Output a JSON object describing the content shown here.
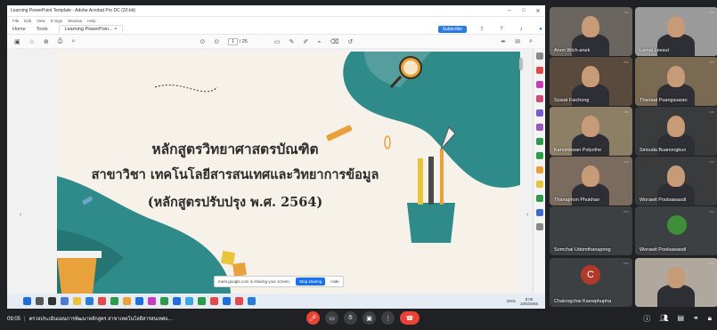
{
  "window": {
    "title": "Learning PowerPoint Template - Adobe Acrobat Pro DC (32-bit)",
    "controls": [
      "–",
      "□",
      "✕"
    ]
  },
  "menu": [
    "File",
    "Edit",
    "View",
    "E-Sign",
    "Window",
    "Help"
  ],
  "tabs": {
    "home": "Home",
    "tools": "Tools",
    "document": "Learning PowerPoin...",
    "close": "×",
    "subscribe": "Subscribe"
  },
  "toolbar": {
    "page_current": "1",
    "page_total": "/ 25"
  },
  "slide": {
    "line1": "หลักสูตรวิทยาศาสตรบัณฑิต",
    "line2": "สาขาวิชา เทคโนโลยีสารสนเทศและวิทยาการข้อมูล",
    "line3": "(หลักสูตรปรับปรุง พ.ศ. 2564)"
  },
  "share_notice": {
    "text": "meet.google.com is sharing your screen.",
    "stop": "Stop sharing",
    "hide": "Hide"
  },
  "taskbar": {
    "tray": "ENG",
    "time": "9:05",
    "date": "10/6/2565"
  },
  "participants": [
    {
      "name": "Anon Wich-anek",
      "bg": "#6b6560"
    },
    {
      "name": "Lamai Leesut",
      "bg": "#9a9a9a"
    },
    {
      "name": "Suwat Faichong",
      "bg": "#5a4a3e"
    },
    {
      "name": "Thanaat Puangsuwan",
      "bg": "#7a6a52"
    },
    {
      "name": "Kanomkwan Polyothe",
      "bg": "#8d7f66"
    },
    {
      "name": "Sirisuda Buanongkuo",
      "bg": "#3a3b3d"
    },
    {
      "name": "Thanaphon Phukhao",
      "bg": "#7a6b5e"
    },
    {
      "name": "Worawit Poolsawasdi",
      "bg": "#3a3b3d"
    },
    {
      "name": "Somchai Udomthanapong",
      "bg": "#3c4043"
    },
    {
      "name": "Worawit Poolsawasdi",
      "bg": "#3c4043"
    },
    {
      "name": "Chalongchai Kaewphupha",
      "bg": "#3c4043",
      "initial": "C"
    },
    {
      "name": "",
      "bg": "#b0a89c"
    }
  ],
  "meeting": {
    "time": "09:05",
    "separator": "|",
    "title": "ตรวจประเมินแผนการพัฒนาหลักสูตร สาขาเทคโนโลยีสารสนเทศแ..."
  },
  "colors": {
    "teal": "#2f8a8a",
    "accent_blue": "#1a73e8",
    "end_red": "#ea4335"
  }
}
